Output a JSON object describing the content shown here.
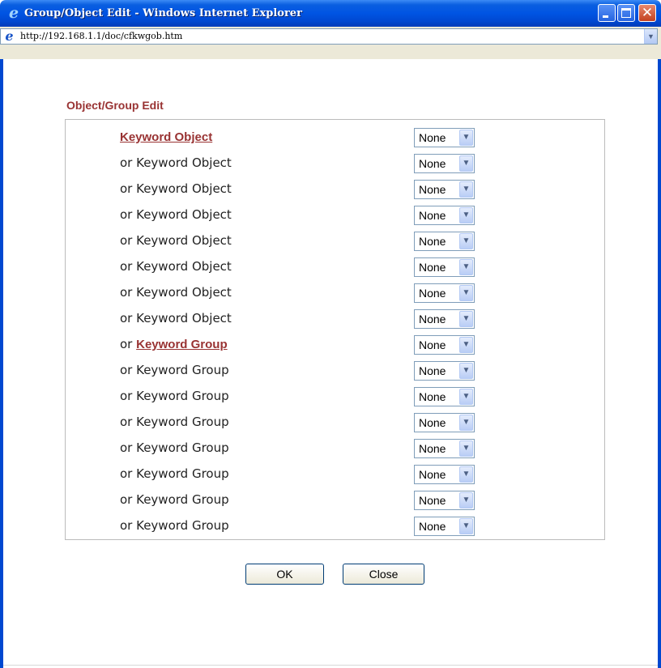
{
  "window": {
    "title": "Group/Object Edit - Windows Internet Explorer",
    "close_glyph": "✕",
    "icons": {
      "app": "ie-logo",
      "minimize": "minimize-icon",
      "maximize": "maximize-icon",
      "close": "close-icon"
    }
  },
  "address": {
    "url": "http://192.168.1.1/doc/cfkwgob.htm",
    "dropdown_glyph": "▼"
  },
  "form": {
    "heading": "Object/Group Edit",
    "rows": [
      {
        "prefix": "",
        "label": "Keyword Object",
        "link": true,
        "value": "None"
      },
      {
        "prefix": "",
        "label": "or Keyword Object",
        "link": false,
        "value": "None"
      },
      {
        "prefix": "",
        "label": "or Keyword Object",
        "link": false,
        "value": "None"
      },
      {
        "prefix": "",
        "label": "or Keyword Object",
        "link": false,
        "value": "None"
      },
      {
        "prefix": "",
        "label": "or Keyword Object",
        "link": false,
        "value": "None"
      },
      {
        "prefix": "",
        "label": "or Keyword Object",
        "link": false,
        "value": "None"
      },
      {
        "prefix": "",
        "label": "or Keyword Object",
        "link": false,
        "value": "None"
      },
      {
        "prefix": "",
        "label": "or Keyword Object",
        "link": false,
        "value": "None"
      },
      {
        "prefix": "or ",
        "label": "Keyword Group",
        "link": true,
        "value": "None"
      },
      {
        "prefix": "",
        "label": "or Keyword Group",
        "link": false,
        "value": "None"
      },
      {
        "prefix": "",
        "label": "or Keyword Group",
        "link": false,
        "value": "None"
      },
      {
        "prefix": "",
        "label": "or Keyword Group",
        "link": false,
        "value": "None"
      },
      {
        "prefix": "",
        "label": "or Keyword Group",
        "link": false,
        "value": "None"
      },
      {
        "prefix": "",
        "label": "or Keyword Group",
        "link": false,
        "value": "None"
      },
      {
        "prefix": "",
        "label": "or Keyword Group",
        "link": false,
        "value": "None"
      },
      {
        "prefix": "",
        "label": "or Keyword Group",
        "link": false,
        "value": "None"
      }
    ],
    "select_arrow_glyph": "▼"
  },
  "buttons": {
    "ok": "OK",
    "close": "Close"
  },
  "colors": {
    "title_bar": "#0054e3",
    "heading": "#993333",
    "link": "#993333",
    "panel_border": "#bbbbbb"
  }
}
